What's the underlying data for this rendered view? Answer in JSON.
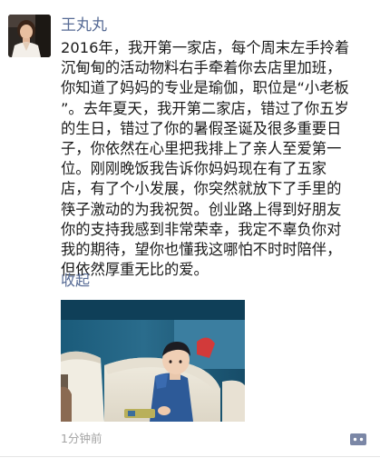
{
  "post": {
    "author": "王丸丸",
    "text_lines": [
      "2016年，我开第一家店，每个周末左手拎着",
      "沉甸甸的活动物料右手牵着你去店里加班，",
      "你知道了妈妈的专业是瑜伽，职位是“小老板",
      "”。去年夏天，我开第二家店，错过了你五岁",
      "的生日，错过了你的暑假圣诞及很多重要日",
      "子，你依然在心里把我排上了亲人至爱第一",
      "位。刚刚晚饭我告诉你妈妈现在有了五家",
      "店，有了个小发展，你突然就放下了手里的",
      "筷子激动的为我祝贺。创业路上得到好朋友",
      "你的支持我感到非常荣幸，我定不辜负你对",
      "我的期待，望你也懂我这哪怕不时时陪伴，",
      "但依然厚重无比的爱。"
    ],
    "collapse_label": "收起",
    "timestamp": "1分钟前"
  },
  "icons": {
    "avatar": "profile-photo-woman",
    "comment": "comment-dots-icon"
  },
  "colors": {
    "name_link": "#576b95",
    "body_text": "#1a1a1a",
    "timestamp": "#a3a3a3",
    "comment_button_bg": "#7b87a6",
    "divider": "#e5e5e5"
  }
}
